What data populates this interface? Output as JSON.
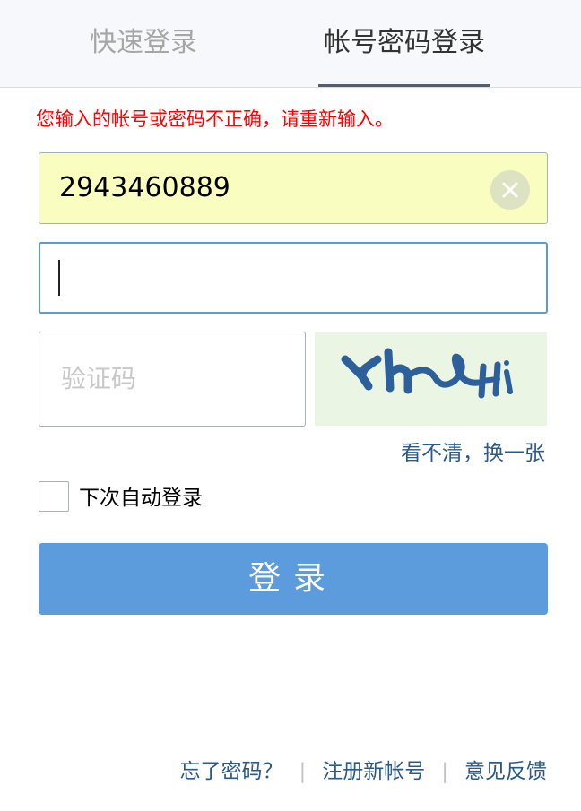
{
  "tabs": {
    "quick_login": "快速登录",
    "account_login": "帐号密码登录",
    "active": "account_login"
  },
  "error_message": "您输入的帐号或密码不正确，请重新输入。",
  "account": {
    "value": "2943460889",
    "clear_icon": "close-icon"
  },
  "password": {
    "value": ""
  },
  "captcha": {
    "placeholder": "验证码",
    "image_text": "Yh4H",
    "refresh_label": "看不清，换一张"
  },
  "auto_login": {
    "label": "下次自动登录",
    "checked": false
  },
  "login_button": {
    "label": "登录"
  },
  "footer": {
    "forgot_password": "忘了密码？",
    "register": "注册新帐号",
    "feedback": "意见反馈",
    "separator": "|"
  },
  "colors": {
    "error": "#ff0000",
    "account_field_bg": "#fafdc0",
    "focus_border": "#5b9bd5",
    "button_bg": "#5c9bdc",
    "link": "#2a5a8a",
    "captcha_ink": "#2d5f9a"
  }
}
